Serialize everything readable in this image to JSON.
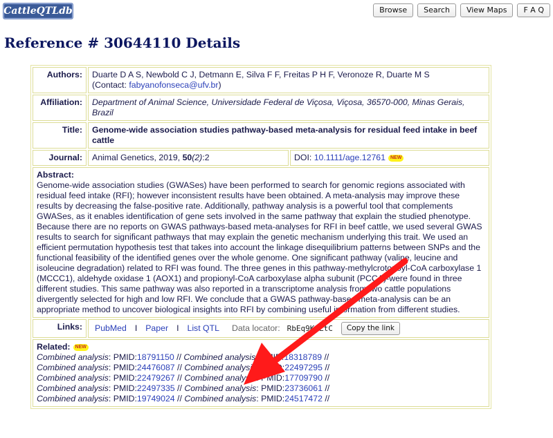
{
  "header": {
    "logo": "CattleQTLdb",
    "buttons": [
      "Browse",
      "Search",
      "View Maps",
      "F A Q"
    ]
  },
  "page_title": "Reference # 30644110 Details",
  "authors": {
    "label": "Authors:",
    "names": "Duarte D A S, Newbold C J, Detmann E, Silva F F, Freitas P H F, Veronoze R, Duarte M S",
    "contact_prefix": "(Contact: ",
    "contact_email": "fabyanofonseca@ufv.br",
    "contact_suffix": ")"
  },
  "affiliation": {
    "label": "Affiliation:",
    "text": "Department of Animal Science, Universidade Federal de Viçosa, Viçosa, 36570-000, Minas Gerais, Brazil"
  },
  "title_field": {
    "label": "Title:",
    "text": "Genome-wide association studies pathway-based meta-analysis for residual feed intake in beef cattle"
  },
  "journal": {
    "label": "Journal:",
    "name": "Animal Genetics, 2019, ",
    "volume": "50",
    "issue": "(2)",
    "pages": ":2",
    "doi_label": "DOI: ",
    "doi": "10.1111/age.12761",
    "badge": "NEW"
  },
  "abstract": {
    "label": "Abstract:",
    "text": "Genome-wide association studies (GWASes) have been performed to search for genomic regions associated with residual feed intake (RFI); however inconsistent results have been obtained. A meta-analysis may improve these results by decreasing the false-positive rate. Additionally, pathway analysis is a powerful tool that complements GWASes, as it enables identification of gene sets involved in the same pathway that explain the studied phenotype. Because there are no reports on GWAS pathways-based meta-analyses for RFI in beef cattle, we used several GWAS results to search for significant pathways that may explain the genetic mechanism underlying this trait. We used an efficient permutation hypothesis test that takes into account the linkage disequilibrium patterns between SNPs and the functional feasibility of the identified genes over the whole genome. One significant pathway (valine, leucine and isoleucine degradation) related to RFI was found. The three genes in this pathway-methylcrotonoyl-CoA carboxylase 1 (MCCC1), aldehyde oxidase 1 (AOX1) and propionyl-CoA carboxylase alpha subunit (PCCA)-were found in three different studies. This same pathway was also reported in a transcriptome analysis from two cattle populations divergently selected for high and low RFI. We conclude that a GWAS pathway-based meta-analysis can be an appropriate method to uncover biological insights into RFI by combining useful information from different studies."
  },
  "links": {
    "label": "Links:",
    "items": [
      "PubMed",
      "Paper",
      "List QTL"
    ],
    "separator": "I",
    "doc_locator_label": "Data locator:",
    "doc_locator_value": "RbEq9K9LtC",
    "copy_button": "Copy the link"
  },
  "related": {
    "label": "Related:",
    "badge": "NEW",
    "type_label": "Combined analysis",
    "pmid_prefix": "PMID:",
    "sep": " // ",
    "rows": [
      [
        "18791150",
        "18318789"
      ],
      [
        "24476087",
        "22497295"
      ],
      [
        "22479267",
        "17709790"
      ],
      [
        "22497335",
        "23736061"
      ],
      [
        "19749024",
        "24517472"
      ]
    ]
  },
  "colors": {
    "arrow": "#ff1a1a",
    "link": "#2a3fb8",
    "title": "#0d1760",
    "border": "#dcdc96"
  }
}
